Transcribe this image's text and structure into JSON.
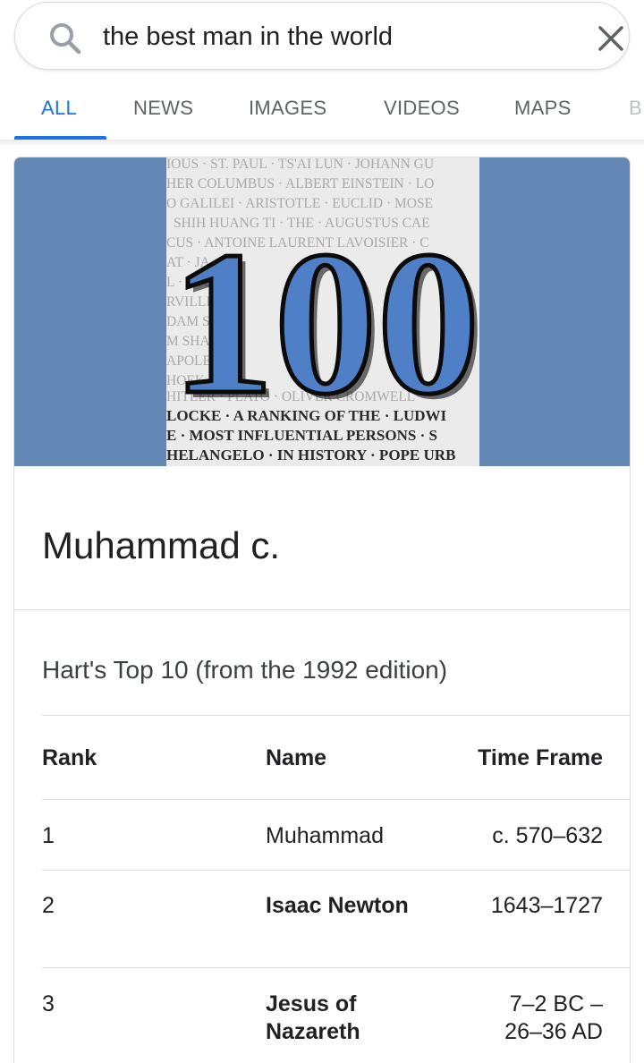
{
  "search": {
    "query": "the best man in the world"
  },
  "tabs": [
    {
      "label": "ALL"
    },
    {
      "label": "NEWS"
    },
    {
      "label": "IMAGES"
    },
    {
      "label": "VIDEOS"
    },
    {
      "label": "MAPS"
    },
    {
      "label": "B"
    }
  ],
  "cover": {
    "lines": [
      "IOUS · ST. PAUL · TS'AI LUN · JOHANN GU",
      "HER COLUMBUS · ALBERT EINSTEIN · LO",
      "O GALILEI · ARISTOTLE · EUCLID · MOSE",
      "SHIH HUANG TI · THE · AUGUSTUS CAE",
      "CUS · ANTOINE LAURENT LAVOISIER · C",
      "AT · JA",
      "L · MART",
      "RVILLE",
      "DAM SM",
      "M SHAK",
      "APOLEO",
      "HOEK",
      "HITLER · PLATO · OLIVER CROMWELL",
      "LOCKE · A RANKING OF THE · LUDWI",
      "E · MOST INFLUENTIAL PERSONS · S",
      "HELANGELO · IN HISTORY · POPE URB"
    ],
    "number": "100"
  },
  "entity": {
    "title": "Muhammad c."
  },
  "table": {
    "title": "Hart's Top 10 (from the 1992 edition)",
    "headers": {
      "rank": "Rank",
      "name": "Name",
      "time": "Time Frame"
    },
    "rows": [
      {
        "rank": "1",
        "name": "Muhammad",
        "time": "c. 570–632"
      },
      {
        "rank": "2",
        "name": "Isaac Newton",
        "time": "1643–1727"
      },
      {
        "rank": "3",
        "name": "Jesus of Nazareth",
        "time": "7–2 BC – 26–36 AD"
      }
    ]
  }
}
